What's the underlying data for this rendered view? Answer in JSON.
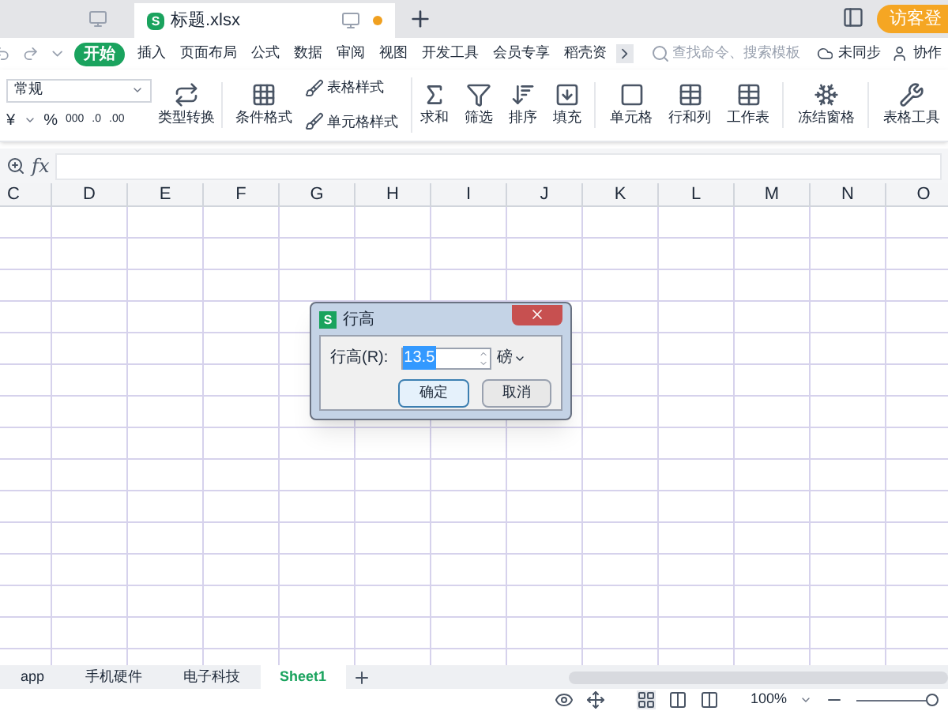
{
  "window": {
    "tab_icon": "S",
    "tab_title": "标题.xlsx",
    "login_button": "访客登"
  },
  "menu": [
    {
      "label": "开始",
      "selected": true
    },
    {
      "label": "插入",
      "selected": false
    },
    {
      "label": "页面布局",
      "selected": false
    },
    {
      "label": "公式",
      "selected": false
    },
    {
      "label": "数据",
      "selected": false
    },
    {
      "label": "审阅",
      "selected": false
    },
    {
      "label": "视图",
      "selected": false
    },
    {
      "label": "开发工具",
      "selected": false
    },
    {
      "label": "会员专享",
      "selected": false
    },
    {
      "label": "稻壳资",
      "selected": false
    }
  ],
  "search": {
    "placeholder": "查找命令、搜索模板"
  },
  "sync": "未同步",
  "collab": "协作",
  "ribbon": {
    "number_format": "常规",
    "currency": "¥",
    "percent": "%",
    "thousands": "000",
    "inc_decimal": ".0",
    "dec_decimal": ".00",
    "convert": "类型转换",
    "cond_format": "条件格式",
    "table_style": "表格样式",
    "cell_style": "单元格样式",
    "tools": [
      {
        "kind": "sum",
        "label": "求和"
      },
      {
        "kind": "filter",
        "label": "筛选"
      },
      {
        "kind": "sort",
        "label": "排序"
      },
      {
        "kind": "fill",
        "label": "填充"
      },
      {
        "kind": "cell",
        "label": "单元格"
      },
      {
        "kind": "rowcol",
        "label": "行和列"
      },
      {
        "kind": "sheet",
        "label": "工作表"
      },
      {
        "kind": "freeze",
        "label": "冻结窗格"
      },
      {
        "kind": "tabletool",
        "label": "表格工具"
      }
    ]
  },
  "formula_bar": {
    "fx": "fx"
  },
  "columns": [
    "C",
    "D",
    "E",
    "F",
    "G",
    "H",
    "I",
    "J",
    "K",
    "L",
    "M",
    "N",
    "O"
  ],
  "dialog": {
    "title": "行高",
    "icon": "S",
    "label": "行高(R):",
    "value": "13.5",
    "unit": "磅",
    "ok": "确定",
    "cancel": "取消"
  },
  "sheets": [
    {
      "label": "app",
      "selected": false
    },
    {
      "label": "手机硬件",
      "selected": false
    },
    {
      "label": "电子科技",
      "selected": false
    },
    {
      "label": "Sheet1",
      "selected": true
    }
  ],
  "status": {
    "zoom": "100%",
    "zoom_slider": {
      "level": 0.95
    }
  }
}
